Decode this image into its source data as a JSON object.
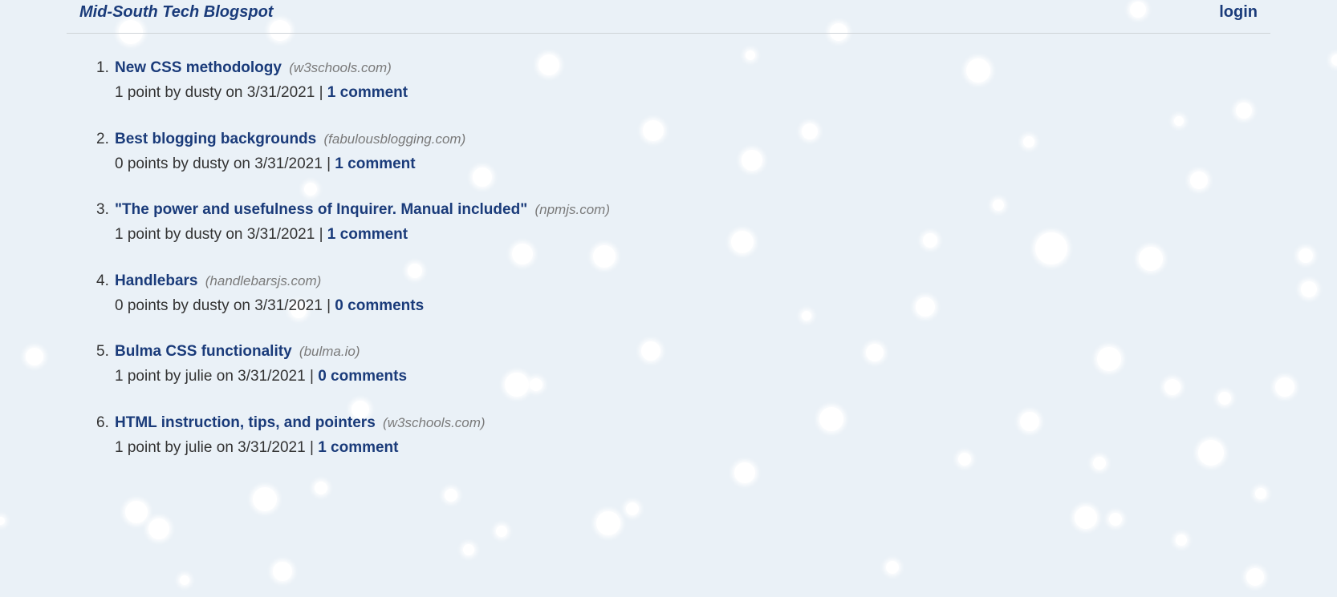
{
  "header": {
    "brand": "Mid-South Tech Blogspot",
    "login_label": "login"
  },
  "posts": [
    {
      "num": "1.",
      "title": "New CSS methodology",
      "domain": "(w3schools.com)",
      "meta": "1 point by dusty on 3/31/2021 |",
      "comments": "1 comment"
    },
    {
      "num": "2.",
      "title": "Best blogging backgrounds",
      "domain": "(fabulousblogging.com)",
      "meta": "0 points by dusty on 3/31/2021 |",
      "comments": "1 comment"
    },
    {
      "num": "3.",
      "title": "\"The power and usefulness of Inquirer. Manual included\"",
      "domain": "(npmjs.com)",
      "meta": "1 point by dusty on 3/31/2021 |",
      "comments": "1 comment"
    },
    {
      "num": "4.",
      "title": "Handlebars",
      "domain": "(handlebarsjs.com)",
      "meta": "0 points by dusty on 3/31/2021 |",
      "comments": "0 comments"
    },
    {
      "num": "5.",
      "title": "Bulma CSS functionality",
      "domain": "(bulma.io)",
      "meta": "1 point by julie on 3/31/2021 |",
      "comments": "0 comments"
    },
    {
      "num": "6.",
      "title": "HTML instruction, tips, and pointers",
      "domain": "(w3schools.com)",
      "meta": "1 point by julie on 3/31/2021 |",
      "comments": "1 comment"
    }
  ],
  "colors": {
    "background": "#eaf1f7",
    "link": "#1a3b7a",
    "domain": "#7a7a7a",
    "text": "#333333"
  }
}
